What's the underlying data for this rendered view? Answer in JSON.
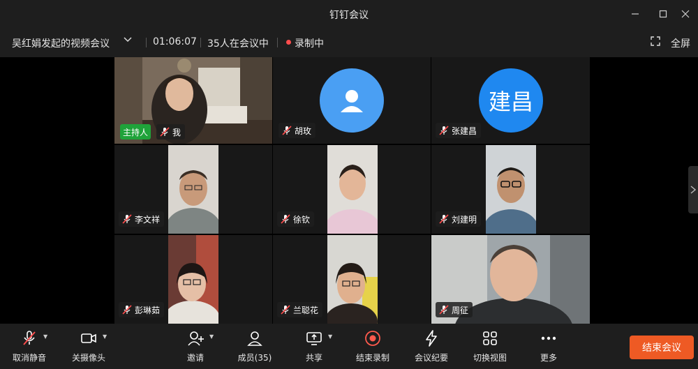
{
  "window": {
    "title": "钉钉会议"
  },
  "meeting": {
    "title": "吴红娟发起的视频会议",
    "duration": "01:06:07",
    "participants_text": "35人在会议中",
    "recording_label": "录制中",
    "fullscreen_label": "全屏"
  },
  "tiles": [
    {
      "name": "我",
      "host_label": "主持人",
      "type": "video"
    },
    {
      "name": "胡玫",
      "type": "avatar-default"
    },
    {
      "name": "张建昌",
      "type": "avatar-text",
      "avatar_text": "建昌"
    },
    {
      "name": "李文祥",
      "type": "video"
    },
    {
      "name": "徐钦",
      "type": "video"
    },
    {
      "name": "刘建明",
      "type": "video"
    },
    {
      "name": "彭琳茹",
      "type": "video"
    },
    {
      "name": "兰聪花",
      "type": "video"
    },
    {
      "name": "周征",
      "type": "video"
    }
  ],
  "toolbar": {
    "unmute": "取消静音",
    "camera_off": "关摄像头",
    "invite": "邀请",
    "members": "成员(35)",
    "share": "共享",
    "end_recording": "结束录制",
    "minutes": "会议纪要",
    "switch_view": "切换视图",
    "more": "更多",
    "end_meeting": "结束会议"
  },
  "colors": {
    "accent_green": "#1fa33a",
    "end_button": "#ee5a24",
    "record_red": "#ff4d4d",
    "avatar_blue": "#4a9ff3"
  }
}
